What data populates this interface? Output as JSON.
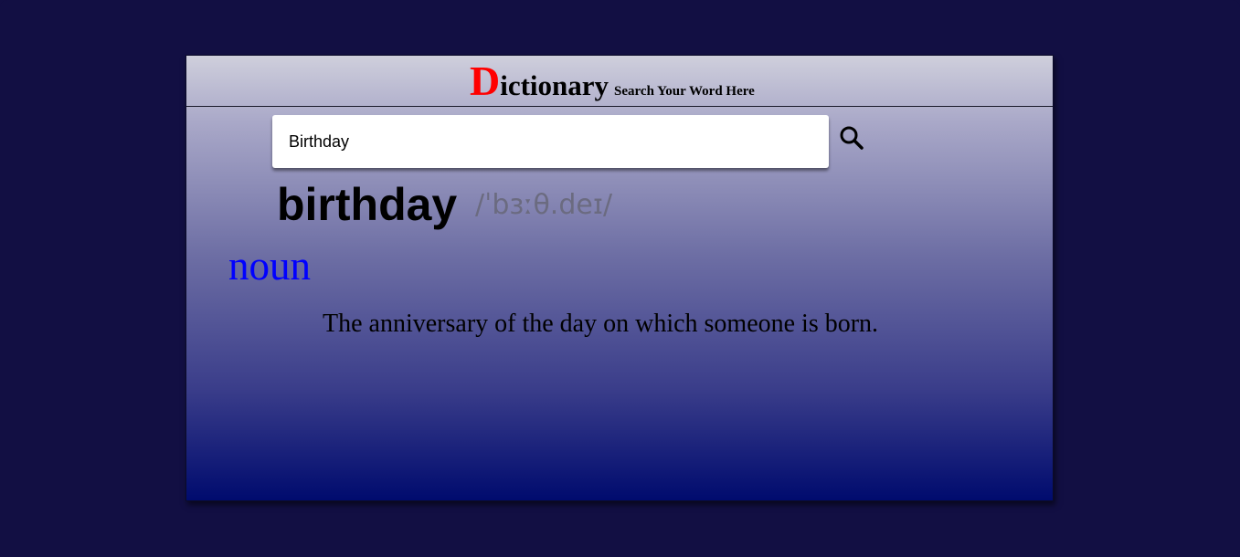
{
  "header": {
    "brand_initial": "D",
    "brand_rest": "ictionary",
    "tagline": "Search Your Word Here"
  },
  "search": {
    "value": "Birthday",
    "icon": "search-icon"
  },
  "result": {
    "word": "birthday",
    "phonetic": "/ˈbɜːθ.deɪ/",
    "part_of_speech": "noun",
    "definition": "The anniversary of the day on which someone is born."
  },
  "colors": {
    "background": "#120f43",
    "brand_initial": "#ff0000",
    "part_of_speech": "#0000ff",
    "phonetic": "#6b6b80"
  }
}
